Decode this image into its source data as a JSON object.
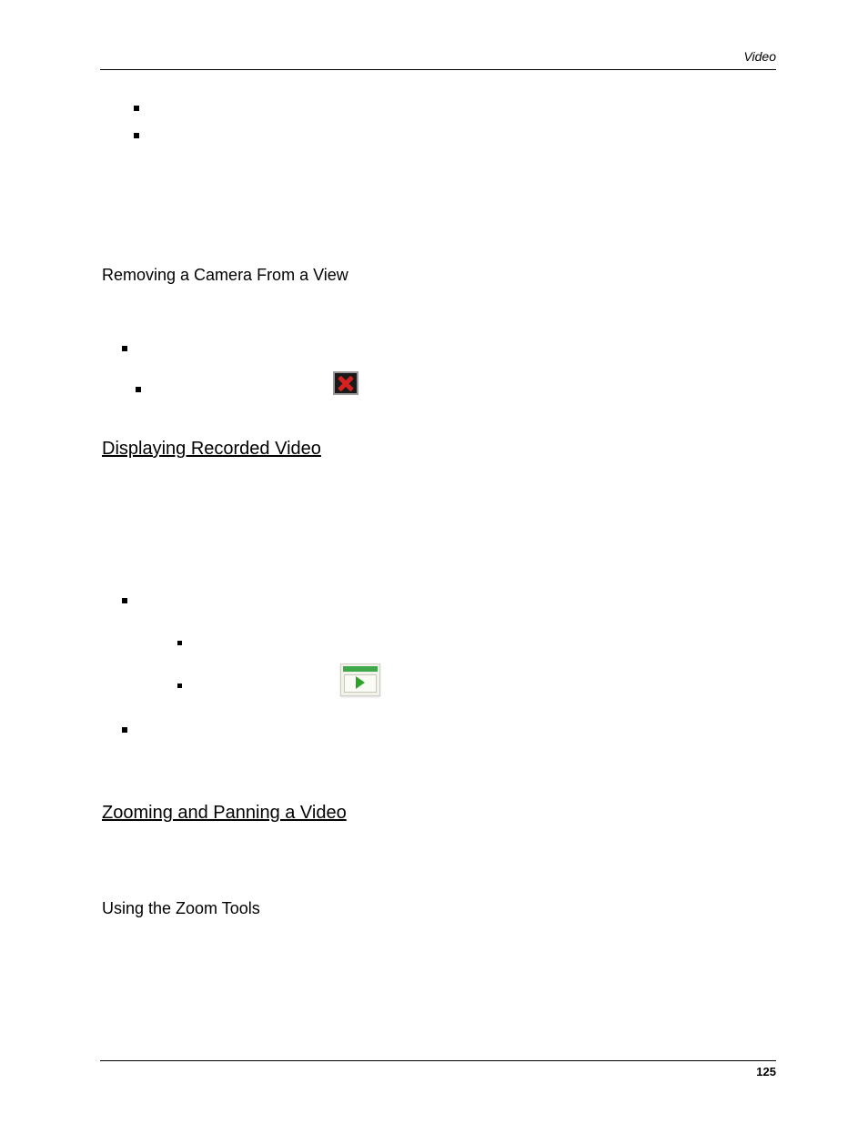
{
  "header": {
    "section_label": "Video"
  },
  "content": {
    "removing_heading": "Removing a Camera From a View",
    "displaying_heading": "Displaying Recorded Video",
    "zooming_heading": "Zooming and Panning a Video",
    "using_zoom_heading": "Using the Zoom Tools"
  },
  "icons": {
    "close": "close-x-icon",
    "play_window": "play-window-icon"
  },
  "footer": {
    "page_number": "125"
  }
}
